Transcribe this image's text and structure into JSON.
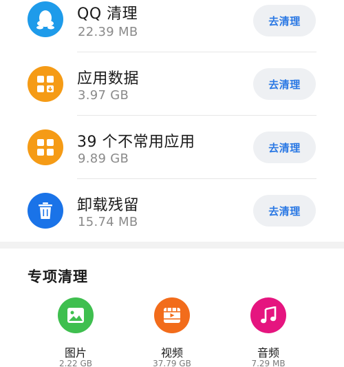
{
  "items": [
    {
      "title": "QQ 清理",
      "size": "22.39 MB",
      "button": "去清理",
      "icon": "qq-icon",
      "icon_color": "#1e9bea"
    },
    {
      "title": "应用数据",
      "size": "3.97 GB",
      "button": "去清理",
      "icon": "app-data-icon",
      "icon_color": "#f59b16"
    },
    {
      "title": "39 个不常用应用",
      "size": "9.89 GB",
      "button": "去清理",
      "icon": "apps-grid-icon",
      "icon_color": "#f59b16"
    },
    {
      "title": "卸载残留",
      "size": "15.74 MB",
      "button": "去清理",
      "icon": "trash-icon",
      "icon_color": "#1a73e8"
    }
  ],
  "special": {
    "title": "专项清理",
    "items": [
      {
        "label": "图片",
        "size": "2.22 GB",
        "icon": "image-icon",
        "icon_color": "#3fbf4f"
      },
      {
        "label": "视频",
        "size": "37.79 GB",
        "icon": "video-icon",
        "icon_color": "#f26c1b"
      },
      {
        "label": "音频",
        "size": "7.29 MB",
        "icon": "music-icon",
        "icon_color": "#e5157f"
      }
    ]
  },
  "colors": {
    "button_text": "#2a78e4",
    "button_bg": "#eef0f3"
  }
}
